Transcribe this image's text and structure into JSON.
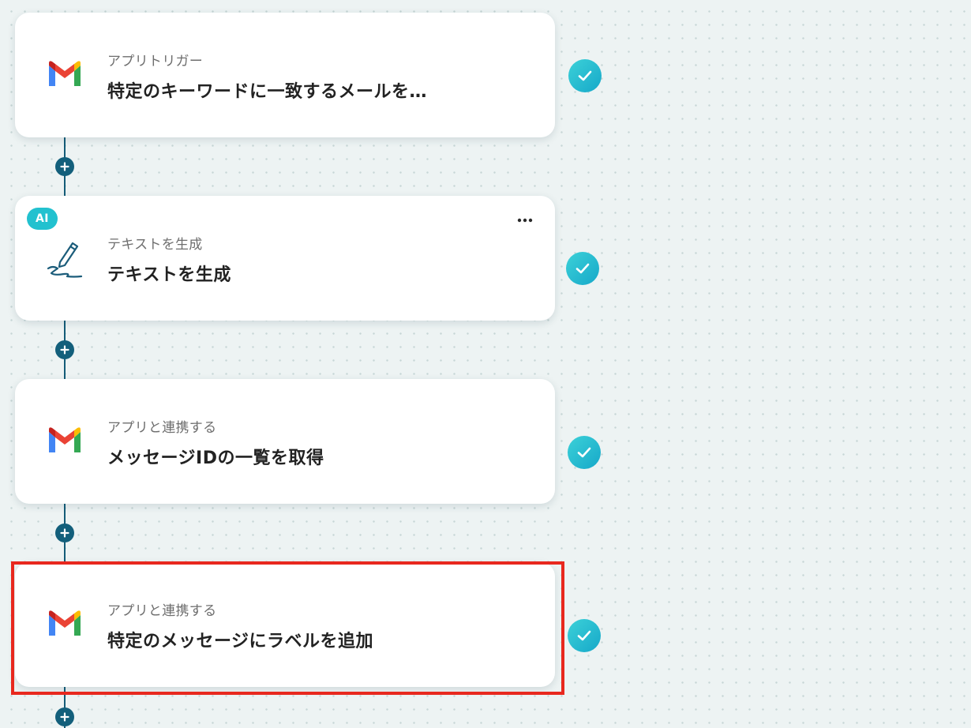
{
  "colors": {
    "canvas_background": "#edf3f3",
    "connector": "#145c78",
    "check_accent": "#22c1cf",
    "highlight_border": "#e8281e",
    "ai_badge": "#22c1cf"
  },
  "flow": {
    "steps": [
      {
        "subtitle": "アプリトリガー",
        "title": "特定のキーワードに一致するメールを…",
        "icon": "gmail-icon",
        "status": "completed"
      },
      {
        "badge": "AI",
        "subtitle": "テキストを生成",
        "title": "テキストを生成",
        "icon": "pen-icon",
        "status": "completed",
        "more_label": "…"
      },
      {
        "subtitle": "アプリと連携する",
        "title": "メッセージIDの一覧を取得",
        "icon": "gmail-icon",
        "status": "completed"
      },
      {
        "subtitle": "アプリと連携する",
        "title": "特定のメッセージにラベルを追加",
        "icon": "gmail-icon",
        "status": "completed",
        "highlighted": true
      }
    ]
  }
}
